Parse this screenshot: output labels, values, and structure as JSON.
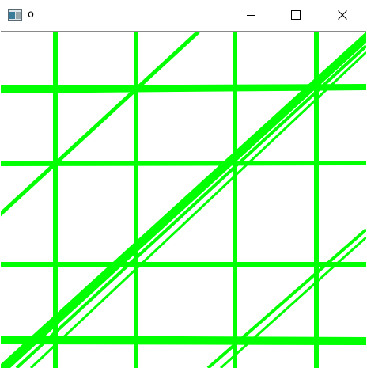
{
  "window": {
    "title": "o"
  },
  "titlebar": {
    "icons": {
      "app": "app-window-icon",
      "minimize": "minimize-icon",
      "maximize": "maximize-icon",
      "close": "close-icon"
    }
  },
  "canvas": {
    "line_color": "#00ff00",
    "background": "#ffffff",
    "description_icon": "detected-lines-image"
  }
}
